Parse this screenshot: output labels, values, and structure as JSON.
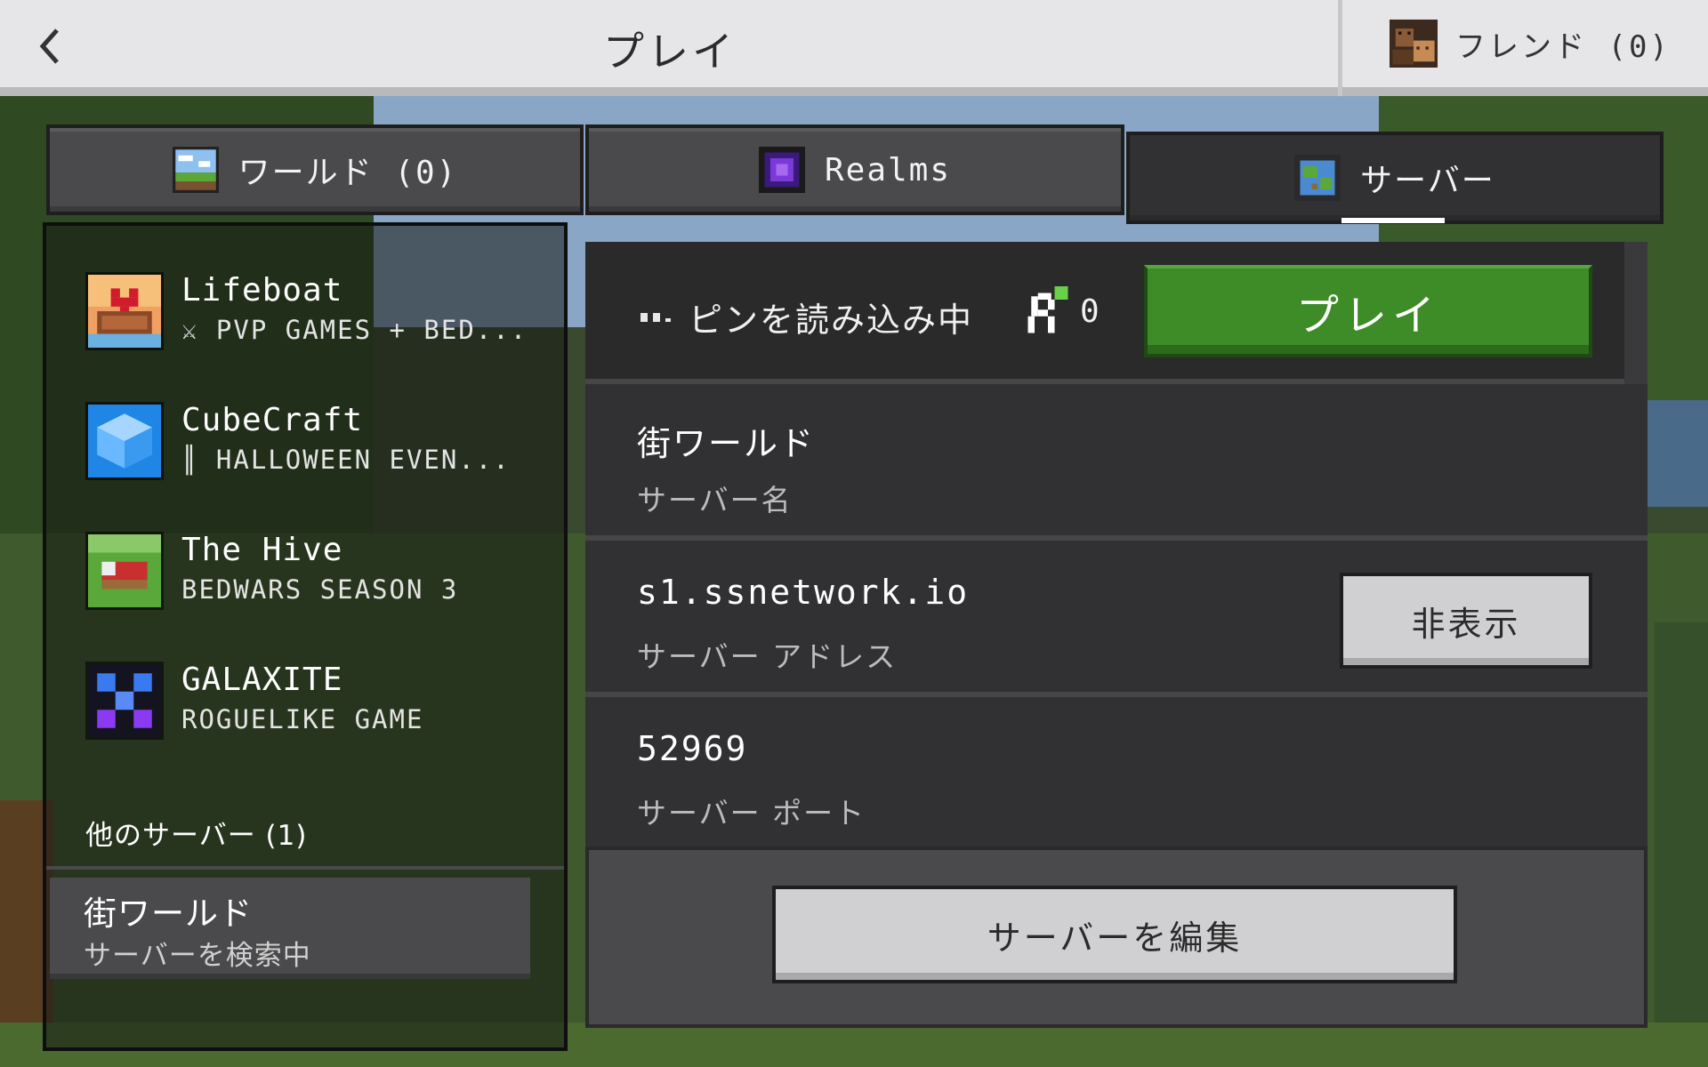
{
  "header": {
    "title": "プレイ",
    "back_icon": "chevron-left-icon",
    "friends_label": "フレンド (0)"
  },
  "tabs": [
    {
      "label": "ワールド (0)",
      "icon": "world-icon",
      "active": false
    },
    {
      "label": "Realms",
      "icon": "realms-portal-icon",
      "active": false
    },
    {
      "label": "サーバー",
      "icon": "globe-icon",
      "active": true
    }
  ],
  "featured_servers": [
    {
      "name": "Lifeboat",
      "subtitle": "⚔ PVP GAMES + BED...",
      "icon": "lifeboat-icon"
    },
    {
      "name": "CubeCraft",
      "subtitle": "║ HALLOWEEN EVEN...",
      "icon": "cubecraft-icon"
    },
    {
      "name": "The Hive",
      "subtitle": "BEDWARS SEASON 3",
      "icon": "the-hive-bed-icon"
    },
    {
      "name": "GALAXITE",
      "subtitle": "ROGUELIKE GAME",
      "icon": "galaxite-icon"
    }
  ],
  "other_servers": {
    "section_label": "他のサーバー (1)",
    "items": [
      {
        "name": "街ワールド",
        "status": "サーバーを検索中"
      }
    ]
  },
  "server_details": {
    "ping_text": "ピンを読み込み中",
    "player_count": "0",
    "play_button": "プレイ",
    "server_name_value": "街ワールド",
    "server_name_label": "サーバー名",
    "address_value": "s1.ssnetwork.io",
    "address_label": "サーバー アドレス",
    "hide_button": "非表示",
    "port_value": "52969",
    "port_label": "サーバー ポート",
    "edit_button": "サーバーを編集"
  },
  "colors": {
    "play_green": "#3d8c28",
    "panel_dark": "#313133",
    "topbar": "#e6e6e9"
  }
}
